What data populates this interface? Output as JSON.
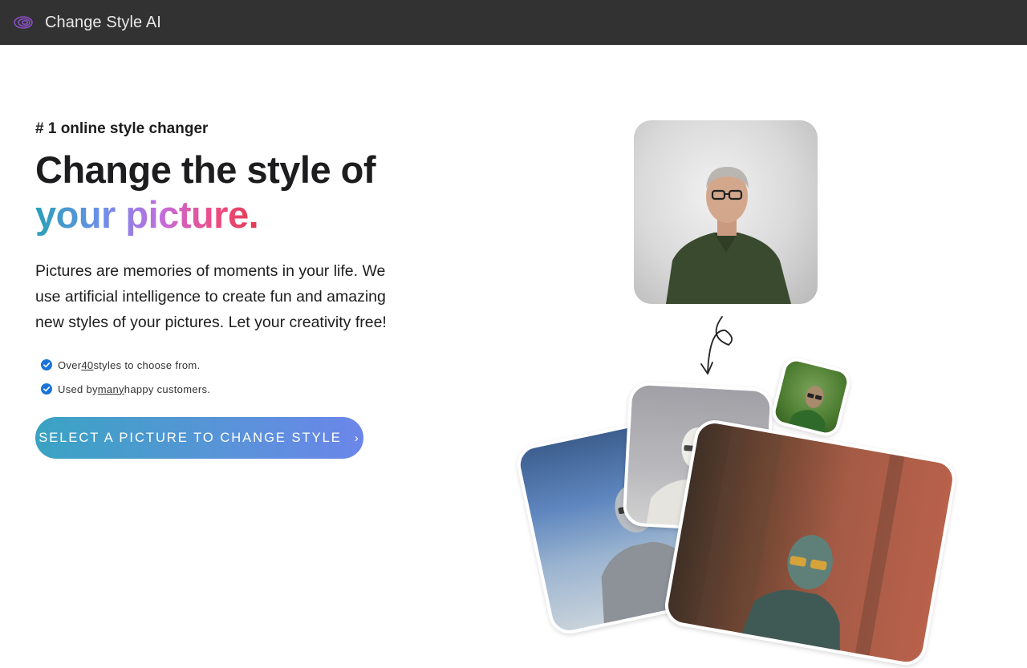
{
  "app": {
    "title": "Change Style AI",
    "logo_icon": "spiral-logo-icon",
    "colors": {
      "topbar": "#323232",
      "accent_start": "#3aa3c3",
      "accent_end": "#6b86ea",
      "check": "#1a73d9"
    }
  },
  "hero": {
    "eyebrow": "# 1 online style changer",
    "headline_line1": "Change the style of",
    "headline_line2": "your picture.",
    "description": "Pictures are memories of moments in your life. We use artificial intelligence to create fun and amazing new styles of your pictures. Let your creativity free!",
    "features": [
      {
        "before": "Over ",
        "emph": "40",
        "after": " styles to choose from."
      },
      {
        "before": "Used by ",
        "emph": "many",
        "after": " happy customers."
      }
    ],
    "cta_label": "SELECT A PICTURE TO CHANGE STYLE",
    "cta_icon": "chevron-right-icon"
  },
  "illustration": {
    "original_photo": "portrait-photo",
    "arrow_icon": "hand-drawn-arrow-icon",
    "styled_examples": [
      "metal-statue-style",
      "white-marble-style",
      "bronze-statue-style",
      "green-grass-style"
    ]
  }
}
